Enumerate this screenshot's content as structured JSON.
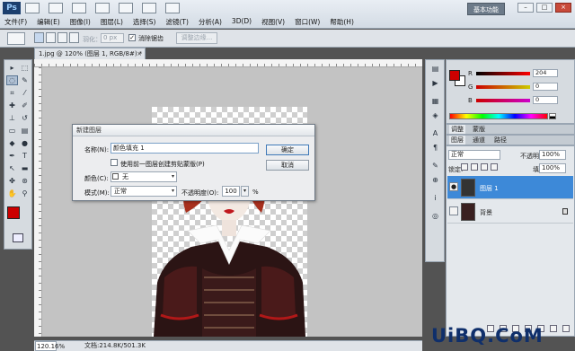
{
  "app": {
    "logo": "Ps",
    "basic_function": "基本功能"
  },
  "window_controls": {
    "minimize": "–",
    "restore": "□",
    "close": "×"
  },
  "menu": [
    "文件(F)",
    "编辑(E)",
    "图像(I)",
    "图层(L)",
    "选择(S)",
    "滤镜(T)",
    "分析(A)",
    "3D(D)",
    "视图(V)",
    "窗口(W)",
    "帮助(H)"
  ],
  "options": {
    "feather_label": "羽化：",
    "feather_value": "0 px",
    "antialias_label": "消除锯齿",
    "antialias_checked": "✓",
    "refine_edge": "调整边缘..."
  },
  "document": {
    "tab_title": "1.jpg @ 120% (图层 1, RGB/8#) *",
    "tab_close": "×",
    "zoom": "120.16%",
    "doc_size": "文档:214.8K/501.3K"
  },
  "dialog": {
    "title": "新建图层",
    "name_label": "名称(N):",
    "name_value": "颜色填充 1",
    "clip_label": "使用前一图层创建剪贴蒙版(P)",
    "color_label": "颜色(C):",
    "color_value": "无",
    "mode_label": "模式(M):",
    "mode_value": "正常",
    "opacity_label": "不透明度(O):",
    "opacity_value": "100",
    "opacity_stepper": "▾",
    "opacity_unit": "%",
    "ok": "确定",
    "cancel": "取消",
    "dropdown_arrow": "▾"
  },
  "color_panel": {
    "fg_color": "#cc0000",
    "bg_color": "#ffffff",
    "channels": [
      {
        "label": "R",
        "value": "204"
      },
      {
        "label": "G",
        "value": "0"
      },
      {
        "label": "B",
        "value": "0"
      }
    ]
  },
  "panel_tabs_1": [
    "调整",
    "蒙版"
  ],
  "panel_tabs_2": [
    "图层",
    "通道",
    "路径"
  ],
  "layers": {
    "blend_mode": "正常",
    "opacity_label": "不透明度:",
    "opacity_value": "100%",
    "lock_label": "锁定:",
    "fill_label": "填充:",
    "fill_value": "100%",
    "items": [
      {
        "name": "图层 1",
        "selected": true,
        "visible_mark": "●"
      },
      {
        "name": "背景",
        "selected": false,
        "visible_mark": ""
      }
    ]
  },
  "watermark": "UiBQ.CoM"
}
